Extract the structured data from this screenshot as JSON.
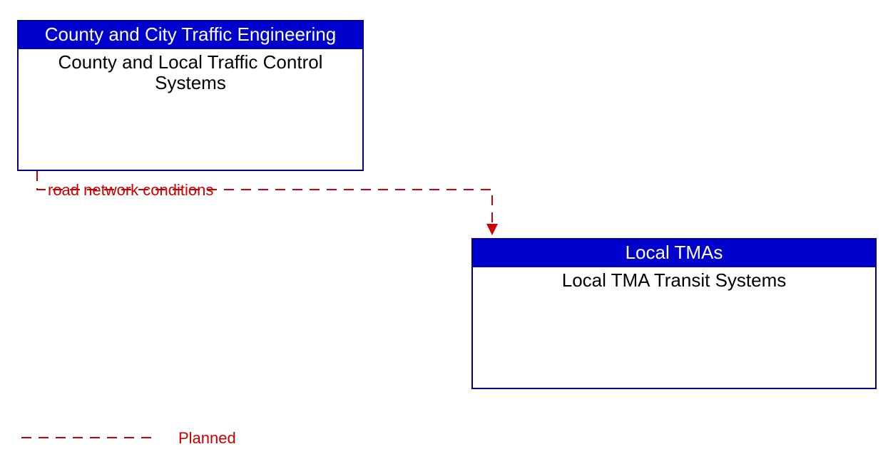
{
  "boxes": {
    "source": {
      "header": "County and City Traffic Engineering",
      "body": "County and Local Traffic Control Systems"
    },
    "target": {
      "header": "Local TMAs",
      "body": "Local TMA Transit Systems"
    }
  },
  "flow": {
    "label": "road network conditions"
  },
  "legend": {
    "planned": "Planned"
  },
  "colors": {
    "header_bg": "#0000cc",
    "border": "#000080",
    "flow": "#cc0000"
  }
}
